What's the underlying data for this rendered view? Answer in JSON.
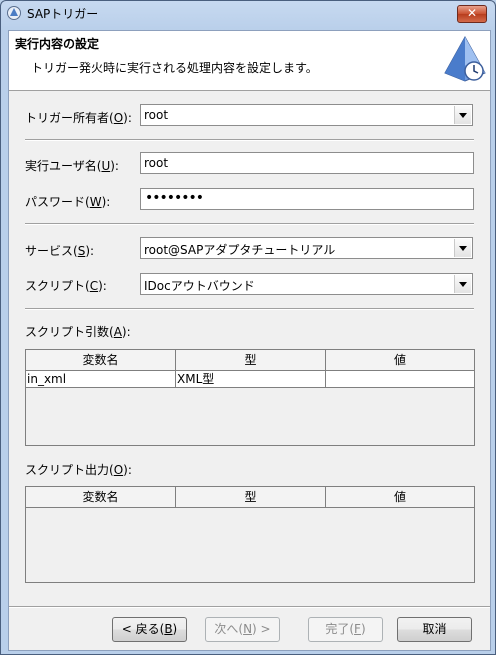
{
  "window": {
    "title": "SAPトリガー",
    "close_label": "✕"
  },
  "header": {
    "title": "実行内容の設定",
    "description": "トリガー発火時に実行される処理内容を設定します。"
  },
  "form": {
    "owner": {
      "label": "トリガー所有者(",
      "mnemonic": "O",
      "suffix": "):",
      "value": "root"
    },
    "exec_user": {
      "label": "実行ユーザ名(",
      "mnemonic": "U",
      "suffix": "):",
      "value": "root"
    },
    "password": {
      "label": "パスワード(",
      "mnemonic": "W",
      "suffix": "):",
      "value": "••••••••"
    },
    "service": {
      "label": "サービス(",
      "mnemonic": "S",
      "suffix": "):",
      "value": "root@SAPアダプタチュートリアル"
    },
    "script": {
      "label": "スクリプト(",
      "mnemonic": "C",
      "suffix": "):",
      "value": "IDocアウトバウンド"
    }
  },
  "args_table": {
    "label": "スクリプト引数(",
    "mnemonic": "A",
    "suffix": "):",
    "columns": [
      "変数名",
      "型",
      "値"
    ],
    "rows": [
      [
        "in_xml",
        "XML型",
        ""
      ]
    ]
  },
  "output_table": {
    "label": "スクリプト出力(",
    "mnemonic": "O",
    "suffix": "):",
    "columns": [
      "変数名",
      "型",
      "値"
    ]
  },
  "buttons": {
    "back": {
      "pre": "< 戻る(",
      "mnemonic": "B",
      "post": ")"
    },
    "next": {
      "pre": "次へ(",
      "mnemonic": "N",
      "post": ") >"
    },
    "finish": {
      "pre": "完了(",
      "mnemonic": "F",
      "post": ")"
    },
    "cancel": {
      "label": "取消"
    }
  }
}
